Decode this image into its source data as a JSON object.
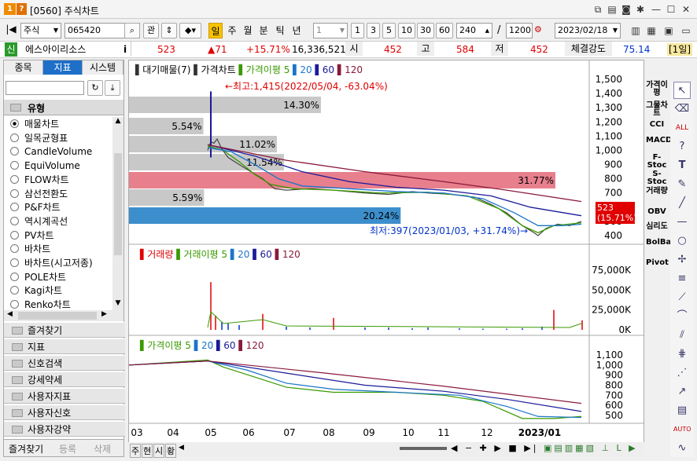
{
  "window": {
    "code": "[0560]",
    "title": "주식차트"
  },
  "toolbar": {
    "market": "주식",
    "code": "065420",
    "search_label": "관",
    "periods": [
      "일",
      "주",
      "월",
      "분",
      "틱",
      "년"
    ],
    "active_period": "일",
    "interval": "1",
    "intervals": [
      "1",
      "3",
      "5",
      "10",
      "30",
      "60"
    ],
    "count": "240",
    "total": "1200",
    "date": "2023/02/18"
  },
  "quote": {
    "flag": "신",
    "name": "에스아이리소스",
    "info_icon": "i",
    "price": "523",
    "change": "▲71",
    "change_pct": "+15.71%",
    "volume": "16,336,521",
    "open_label": "시",
    "open": "452",
    "high_label": "고",
    "high": "584",
    "low_label": "저",
    "low": "452",
    "strength_label": "체결강도",
    "strength": "75.14",
    "period_badge": "[1일]"
  },
  "left_panel": {
    "tabs": [
      "종목",
      "지표",
      "시스템"
    ],
    "active_tab": "지표",
    "group_title": "유형",
    "items": [
      "매물차트",
      "일목균형표",
      "CandleVolume",
      "EquiVolume",
      "FLOW차트",
      "삼선전환도",
      "P&F차트",
      "역시계곡선",
      "PV차트",
      "바차트",
      "바차트(시고저종)",
      "POLE차트",
      "Kagi차트",
      "Renko차트"
    ],
    "folders": [
      "즐겨찾기",
      "지표",
      "신호검색",
      "강세약세",
      "사용자지표",
      "사용자신호",
      "사용자강약"
    ],
    "bottom_tabs": [
      "즐겨찾기",
      "등록",
      "삭제"
    ]
  },
  "price_pane": {
    "legend": [
      "대기매물(7)",
      "가격차트",
      "가격이평",
      "5",
      "20",
      "60",
      "120"
    ],
    "y_ticks": [
      "1,500",
      "1,400",
      "1,300",
      "1,200",
      "1,100",
      "1,000",
      "900",
      "800",
      "700",
      "600",
      "500",
      "400"
    ],
    "high_note": "←최고:1,415(2022/05/04, -63.04%)",
    "low_note": "최저:397(2023/01/03, +31.74%)→",
    "current_price": "523",
    "current_pct": "(15.71%)",
    "profile": [
      {
        "pct": "14.30%",
        "value": 0.143,
        "highlight": false
      },
      {
        "pct": "5.54%",
        "value": 0.0554,
        "highlight": false
      },
      {
        "pct": "11.02%",
        "value": 0.1102,
        "highlight": false
      },
      {
        "pct": "11.54%",
        "value": 0.1154,
        "highlight": false
      },
      {
        "pct": "31.77%",
        "value": 0.3177,
        "highlight": "red"
      },
      {
        "pct": "5.59%",
        "value": 0.0559,
        "highlight": false
      },
      {
        "pct": "20.24%",
        "value": 0.2024,
        "highlight": "blue"
      }
    ]
  },
  "volume_pane": {
    "legend": [
      "거래량",
      "거래이평",
      "5",
      "20",
      "60",
      "120"
    ],
    "y_ticks": [
      "75,000K",
      "50,000K",
      "25,000K",
      "0K"
    ]
  },
  "ma_pane": {
    "legend": [
      "가격이평",
      "5",
      "20",
      "60",
      "120"
    ],
    "y_ticks": [
      "1,100",
      "1,000",
      "900",
      "800",
      "700",
      "600",
      "500"
    ]
  },
  "x_axis": [
    "03",
    "04",
    "05",
    "06",
    "07",
    "08",
    "09",
    "10",
    "11",
    "12",
    "2023/01"
  ],
  "bottom_bar": {
    "tabs": [
      "주",
      "현",
      "시",
      "황"
    ]
  },
  "right_indicators": [
    "가격이평",
    "그물차트",
    "CCI",
    "MACD",
    "F-Stoc",
    "S-Stoc",
    "거래량",
    "OBV",
    "심리도",
    "BolBand",
    "Pivot"
  ],
  "colors": {
    "red": "#e00000",
    "blue": "#0033cc",
    "highlight_red": "#e87f8d",
    "highlight_blue": "#3c8fcc",
    "ma5": "#3a9a00",
    "ma20": "#1a75c8",
    "ma60": "#1a1a99",
    "ma120": "#8a1a3a"
  }
}
